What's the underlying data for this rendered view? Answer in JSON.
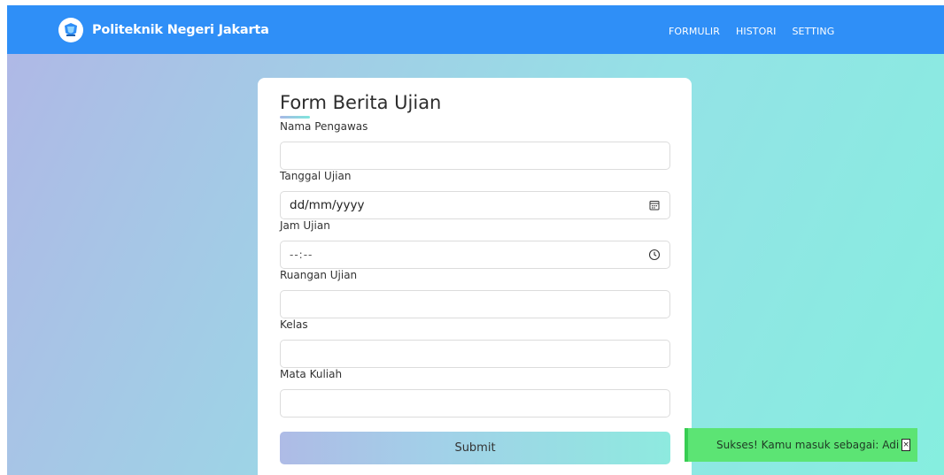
{
  "navbar": {
    "brand": "Politeknik Negeri Jakarta",
    "links": [
      "FORMULIR",
      "HISTORI",
      "SETTING"
    ]
  },
  "form": {
    "title": "Form Berita Ujian",
    "fields": [
      {
        "label": "Nama Pengawas",
        "value": ""
      },
      {
        "label": "Tanggal Ujian",
        "value": "dd/mm/yyyy",
        "icon": "calendar-icon"
      },
      {
        "label": "Jam Ujian",
        "value": "--:--",
        "icon": "clock-icon"
      },
      {
        "label": "Ruangan Ujian",
        "value": ""
      },
      {
        "label": "Kelas",
        "value": ""
      },
      {
        "label": "Mata Kuliah",
        "value": ""
      }
    ],
    "submit_label": "Submit"
  },
  "toast": {
    "message": "Sukses! Kamu masuk sebagai: Adi",
    "close_label": "×"
  },
  "colors": {
    "navbar": "#2f8ff7",
    "toast": "#5ce474",
    "gradient_start": "#b0b7e6",
    "gradient_end": "#86eedf"
  }
}
